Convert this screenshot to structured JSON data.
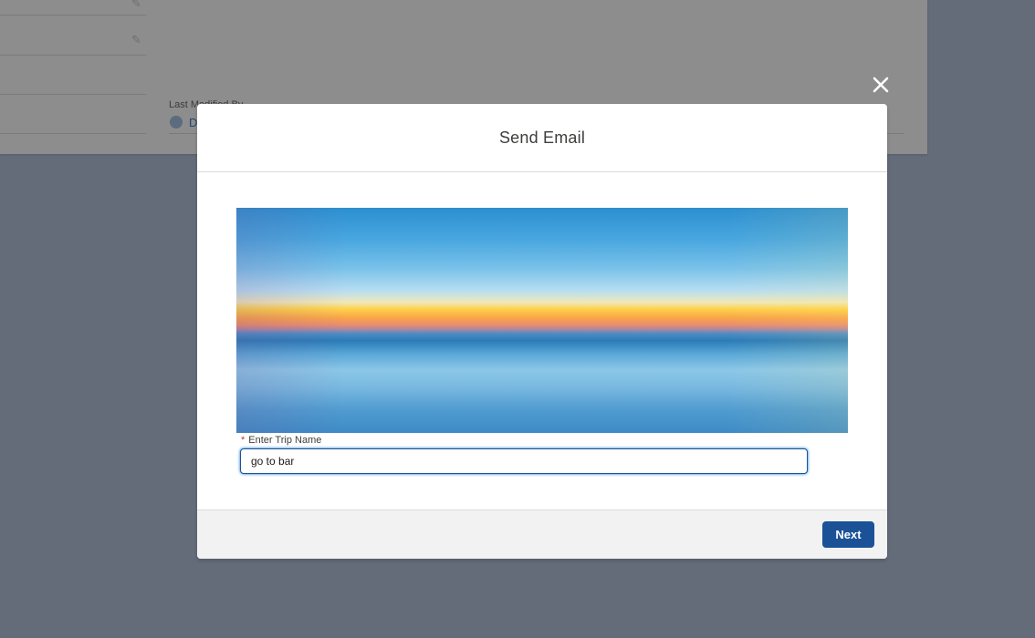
{
  "background_page": {
    "field_label": "Last Modified By",
    "field_value_link": "D"
  },
  "close_icon": "close-icon",
  "modal": {
    "title": "Send Email",
    "hero_image": "sunset-seascape-image",
    "trip_field": {
      "required_marker": "*",
      "label": "Enter Trip Name",
      "value": "go to bar"
    },
    "footer": {
      "next_label": "Next"
    }
  },
  "colors": {
    "brand_button": "#1b5297",
    "overlay": "#646c7a",
    "required": "#c23934"
  }
}
